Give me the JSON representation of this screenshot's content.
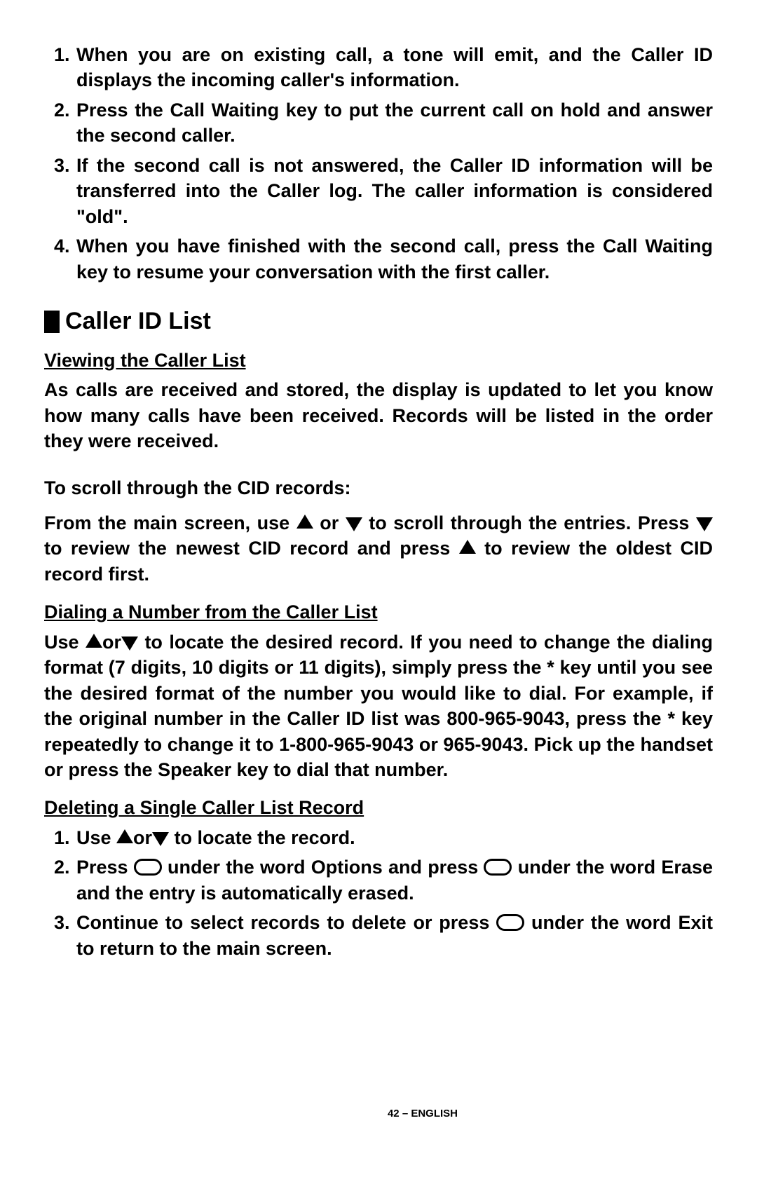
{
  "list1": {
    "i1": "When you are on existing call, a tone will emit, and the Caller ID displays the incoming caller's information.",
    "i2a": "Press the ",
    "i2b": "Call Waiting",
    "i2c": " key to put the current call on hold and answer the second caller.",
    "i3": "If the second call is not answered, the Caller ID information will be transferred into the Caller log. The caller information is considered \"old\".",
    "i4a": "When you have finished with the second call, press the ",
    "i4b": "Call Waiting",
    "i4c": " key to resume your conversation with the first caller."
  },
  "section": {
    "title": "Caller ID List",
    "sub1": "Viewing the Caller List",
    "p1": "As calls are received and stored, the display is updated to let you know how many calls have been received. Records will be listed in the order they were received.",
    "p2": "To scroll through the CID records:",
    "p3": {
      "a": "From the main screen, use",
      "b": "or",
      "c": "to scroll through the entries. Press",
      "d": "to review the newest CID record and press",
      "e": " to review the oldest CID record first."
    },
    "sub2": "Dialing a Number from the Caller List",
    "p4": {
      "a": "Use",
      "b": "or",
      "c": "to locate the desired record.  If you need to change the dialing format (7 digits, 10 digits or 11 digits), simply press the * key until you see the desired format of the number you would like to dial.  For example, if the original number in the Caller ID list was 800-965-9043, press the * key repeatedly to change it to 1-800-965-9043 or 965-9043.  Pick up the handset or press the ",
      "d": "Speaker",
      "e": " key to dial that number."
    },
    "sub3": "Deleting a Single Caller List Record",
    "del": {
      "i1": {
        "a": "Use",
        "b": "or",
        "c": "to locate the record."
      },
      "i2": {
        "a": "Press",
        "b": "under the word ",
        "c": "Options",
        "d": " and press",
        "e": "under the word ",
        "f": "Erase",
        "g": " and the entry is automatically erased."
      },
      "i3": {
        "a": "Continue to select records to delete or press ",
        "b": "under the word ",
        "c": "Exit",
        "d": " to return to the main screen."
      }
    }
  },
  "footer": "42 – ENGLISH"
}
